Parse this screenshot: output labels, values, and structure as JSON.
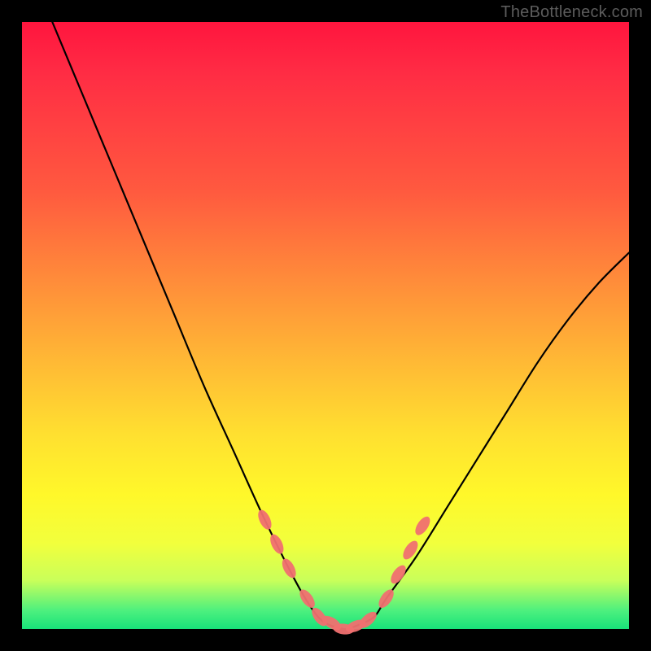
{
  "watermark": "TheBottleneck.com",
  "colors": {
    "frame": "#000000",
    "curve": "#000000",
    "marker": "#f07070",
    "gradient_top": "#ff153e",
    "gradient_bottom": "#18e27a"
  },
  "chart_data": {
    "type": "line",
    "title": "",
    "xlabel": "",
    "ylabel": "",
    "xlim": [
      0,
      100
    ],
    "ylim": [
      0,
      100
    ],
    "note": "No axis ticks or numeric labels are rendered in the source image; x/y are normalized 0–100. y represents bottleneck severity (100 at top, 0 at bottom green band). Curve is a V-shape with minimum near x≈53.",
    "series": [
      {
        "name": "bottleneck-curve",
        "x": [
          5,
          10,
          15,
          20,
          25,
          30,
          35,
          40,
          45,
          48,
          50,
          53,
          55,
          58,
          60,
          65,
          70,
          75,
          80,
          85,
          90,
          95,
          100
        ],
        "y": [
          100,
          88,
          76,
          64,
          52,
          40,
          29,
          18,
          8,
          3,
          1,
          0,
          0.5,
          2,
          5,
          12,
          20,
          28,
          36,
          44,
          51,
          57,
          62
        ]
      }
    ],
    "markers": {
      "name": "highlighted-points",
      "note": "Salmon lozenge markers clustered near the valley of the curve.",
      "x": [
        40,
        42,
        44,
        47,
        49,
        51,
        53,
        55,
        57,
        60,
        62,
        64,
        66
      ],
      "y": [
        18,
        14,
        10,
        5,
        2,
        1,
        0,
        0.5,
        1.5,
        5,
        9,
        13,
        17
      ]
    }
  }
}
